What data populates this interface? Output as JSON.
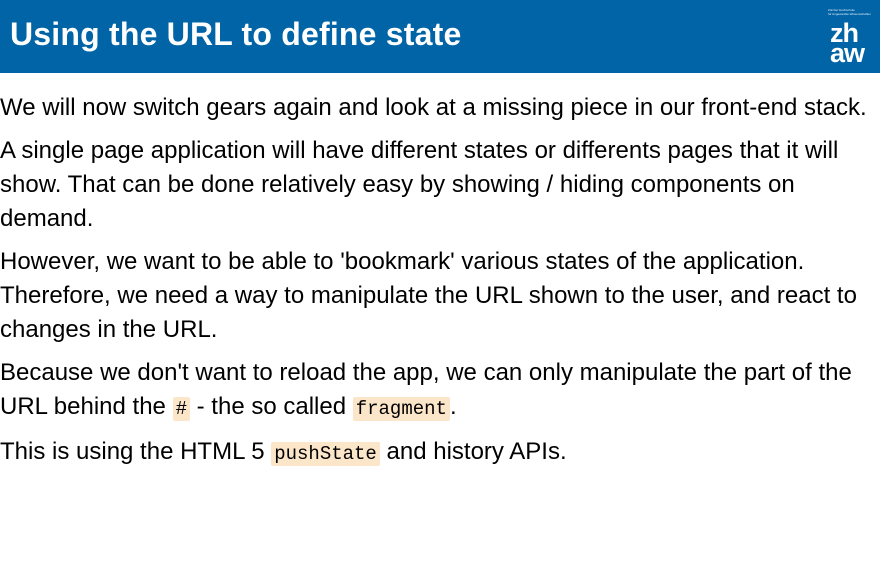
{
  "header": {
    "title": "Using the URL to define state",
    "logo": {
      "small_lines": [
        "Zürcher Hochschule",
        "für Angewandte Wissenschaften"
      ],
      "line1": "zh",
      "line2": "aw",
      "bg_color": "#0064a6"
    }
  },
  "content": {
    "p1": "We will now switch gears again and look at a missing piece in our front-end stack.",
    "p2": "A single page application will have different states or differents pages that it will show. That can be done relatively easy by showing / hiding components on demand.",
    "p3": "However, we want to be able to 'bookmark' various states of the application. Therefore, we need a way to manipulate the URL shown to the user, and react to changes in the URL.",
    "p4": {
      "part1": "Because we don't want to reload the app, we can only manipulate the part of the URL behind the ",
      "code1": "#",
      "part2": " - the so called ",
      "code2": "fragment",
      "part3": "."
    },
    "p5": {
      "part1": "This is using the HTML 5 ",
      "code1": "pushState",
      "part2": " and history APIs."
    }
  }
}
